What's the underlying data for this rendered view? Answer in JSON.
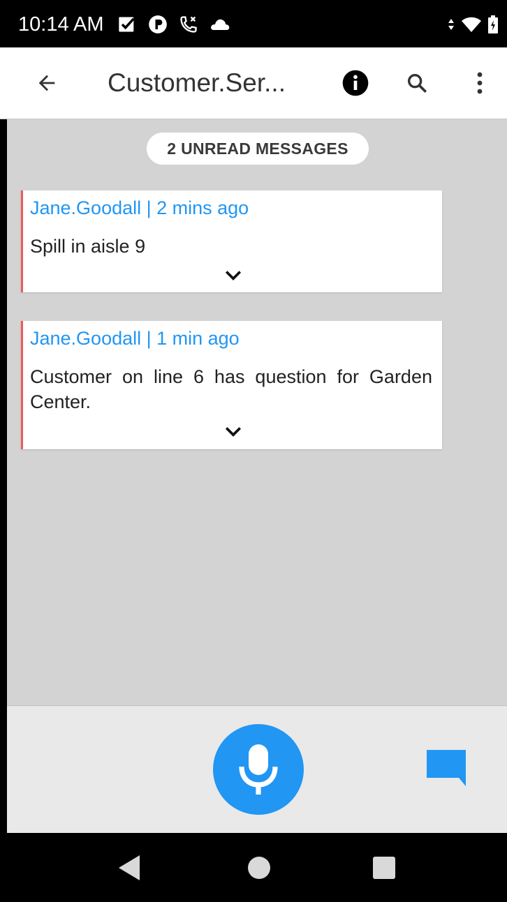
{
  "status_bar": {
    "time": "10:14 AM",
    "left_icons": [
      "checkbox-icon",
      "cloud-app-icon",
      "missed-call-icon",
      "cloud-icon"
    ],
    "right_icons": [
      "data-arrows-icon",
      "wifi-icon",
      "battery-icon"
    ]
  },
  "app_bar": {
    "title": "Customer.Ser...",
    "icons": [
      "back-arrow-icon",
      "info-icon",
      "search-icon",
      "more-vert-icon"
    ]
  },
  "unread_pill": "2 UNREAD MESSAGES",
  "messages": [
    {
      "header": "Jane.Goodall | 2 mins ago",
      "body": "Spill in aisle 9"
    },
    {
      "header": "Jane.Goodall | 1 min ago",
      "body": "Customer on line 6 has question for Garden Center."
    }
  ],
  "bottom_bar": {
    "icons": [
      "mic-icon",
      "chat-icon"
    ]
  },
  "nav_bar": {
    "icons": [
      "nav-back-icon",
      "nav-home-icon",
      "nav-recents-icon"
    ]
  },
  "colors": {
    "accent": "#2196f3",
    "unread_marker": "#ef5a5a",
    "background": "#d3d3d3"
  }
}
